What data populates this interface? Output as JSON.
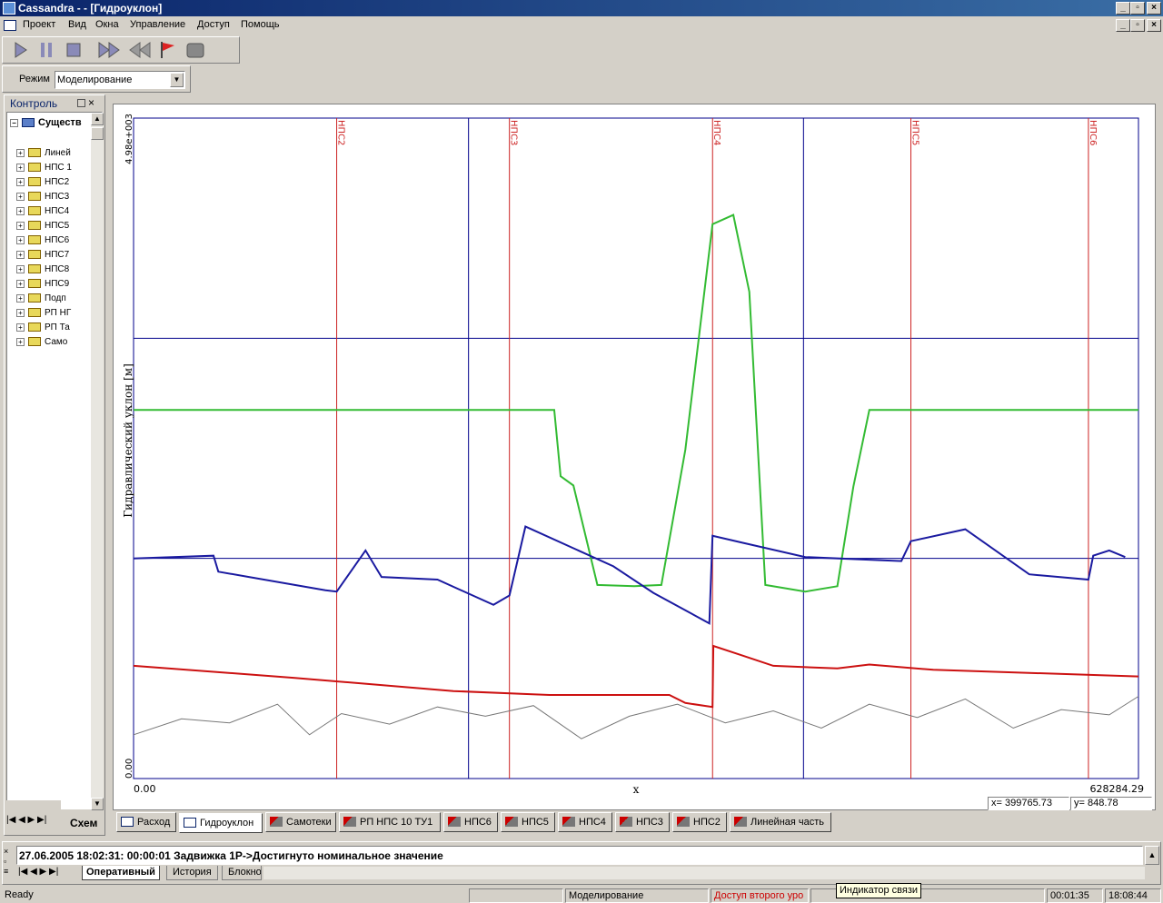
{
  "window": {
    "title": "Cassandra -                    - [Гидроуклон]"
  },
  "menu": [
    "Проект",
    "Вид",
    "Окна",
    "Управление",
    "Доступ",
    "Помощь"
  ],
  "mode": {
    "label": "Режим",
    "value": "Моделирование"
  },
  "left_panel": {
    "title": "Контроль",
    "root": "Существ",
    "items": [
      "Линей",
      "НПС 1",
      "НПС2",
      "НПС3",
      "НПС4",
      "НПС5",
      "НПС6",
      "НПС7",
      "НПС8",
      "НПС9",
      "Подп",
      "РП НГ",
      "РП Та",
      "Само"
    ],
    "bottom_tab": "Схем"
  },
  "chart": {
    "ylabel": "Гидравлический уклон [м]",
    "y_top_tick": "4.98e+003",
    "y_bottom_tick": "0.00",
    "x_left_tick": "0.00",
    "x_right_tick": "628284.29",
    "xlabel": "x",
    "cursor_x": "x= 399765.73",
    "cursor_y": "y= 848.78",
    "station_labels": [
      "НПС2",
      "НПС3",
      "НПС4",
      "НПС5",
      "НПС6"
    ]
  },
  "chart_data": {
    "type": "line",
    "xlabel": "x",
    "ylabel": "Гидравлический уклон [м]",
    "xlim": [
      0,
      628284.29
    ],
    "ylim": [
      0,
      4980
    ],
    "grid": true,
    "markers": [
      {
        "name": "НПС2",
        "x": 127000
      },
      {
        "name": "НПС3",
        "x": 235000
      },
      {
        "name": "НПС4",
        "x": 362000
      },
      {
        "name": "НПС5",
        "x": 486000
      },
      {
        "name": "НПС6",
        "x": 597000
      }
    ],
    "series": [
      {
        "color": "#33bb33",
        "x": [
          0,
          263000,
          267000,
          275000,
          290000,
          313000,
          330000,
          345000,
          362000,
          375000,
          385000,
          395000,
          420000,
          440000,
          450000,
          460000,
          628284
        ],
        "y": [
          2780,
          2780,
          2280,
          2210,
          1460,
          1450,
          1460,
          2480,
          4180,
          4250,
          3670,
          1460,
          1410,
          1450,
          2200,
          2780,
          2780
        ]
      },
      {
        "color": "#1a1aa0",
        "x": [
          0,
          50000,
          53000,
          120000,
          127000,
          145000,
          155000,
          190000,
          225000,
          235000,
          245000,
          300000,
          325000,
          360000,
          362000,
          380000,
          420000,
          480000,
          486000,
          520000,
          560000,
          597000,
          600000,
          610000,
          620000
        ],
        "y": [
          1660,
          1680,
          1560,
          1420,
          1410,
          1720,
          1520,
          1500,
          1310,
          1380,
          1900,
          1600,
          1400,
          1170,
          1830,
          1780,
          1670,
          1640,
          1790,
          1880,
          1540,
          1500,
          1680,
          1720,
          1670
        ]
      },
      {
        "color": "#cc1111",
        "x": [
          0,
          100000,
          200000,
          260000,
          335000,
          345000,
          362000,
          362500,
          380000,
          400000,
          440000,
          460000,
          500000,
          628284
        ],
        "y": [
          850,
          760,
          660,
          630,
          630,
          570,
          540,
          1000,
          930,
          850,
          830,
          860,
          820,
          770
        ]
      },
      {
        "color": "#777777",
        "x": [
          0,
          30000,
          60000,
          90000,
          110000,
          130000,
          160000,
          190000,
          220000,
          250000,
          280000,
          310000,
          340000,
          370000,
          400000,
          430000,
          460000,
          490000,
          520000,
          550000,
          580000,
          610000,
          628284
        ],
        "y": [
          330,
          450,
          420,
          560,
          330,
          490,
          410,
          540,
          470,
          550,
          300,
          470,
          560,
          420,
          510,
          380,
          560,
          460,
          600,
          380,
          520,
          480,
          620
        ]
      }
    ]
  },
  "tabs": [
    "Расход",
    "Гидроуклон",
    "Самотеки",
    "РП НПС 10 ТУ1",
    "НПС6",
    "НПС5",
    "НПС4",
    "НПС3",
    "НПС2",
    "Линейная часть"
  ],
  "messages": {
    "line": "27.06.2005 18:02:31: 00:00:01 Задвижка 1Р->Достигнуто номинальное значение",
    "tabs": [
      "Оперативный",
      "История",
      "Блокно"
    ]
  },
  "status": {
    "ready": "Ready",
    "mode": "Моделирование",
    "access": "Доступ второго уро",
    "tooltip": "Индикатор связи",
    "elapsed": "00:01:35",
    "clock": "18:08:44",
    "access_color": "#cc0000"
  }
}
